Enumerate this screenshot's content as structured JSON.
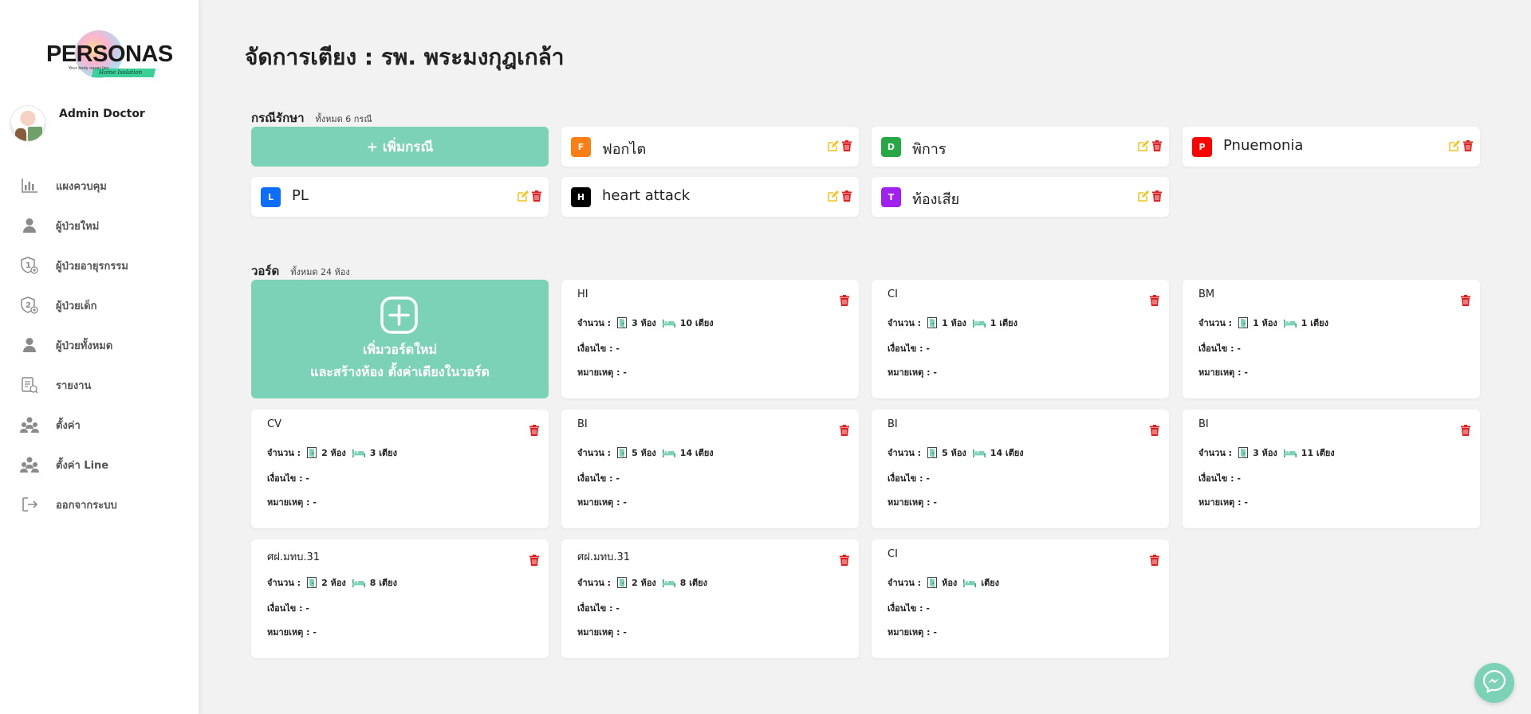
{
  "sidebar": {
    "logo": {
      "text": "PERSONAS",
      "tagline": "Your body never lies",
      "strip": "Home Isolation"
    },
    "profile_name": "Admin Doctor",
    "items": [
      {
        "label": "แผงควบคุม",
        "icon": "bar-chart-icon"
      },
      {
        "label": "ผู้ป่วยใหม่",
        "icon": "user-icon"
      },
      {
        "label": "ผู้ป่วยอายุรกรรม",
        "icon": "shield-one-icon"
      },
      {
        "label": "ผู้ป่วยเด็ก",
        "icon": "shield-two-icon"
      },
      {
        "label": "ผู้ป่วยทั้งหมด",
        "icon": "user-icon"
      },
      {
        "label": "รายงาน",
        "icon": "report-icon"
      },
      {
        "label": "ตั้งค่า",
        "icon": "users-gear-icon"
      },
      {
        "label": "ตั้งค่า Line",
        "icon": "users-gear-icon"
      },
      {
        "label": "ออกจากระบบ",
        "icon": "logout-icon"
      }
    ]
  },
  "main": {
    "title": "จัดการเตียง : รพ. พระมงกุฎเกล้า",
    "cases": {
      "title": "กรณีรักษา",
      "count": "ทั้งหมด 6 กรณี",
      "add_label": "+ เพิ่มกรณี",
      "items": [
        {
          "letter": "F",
          "name": "ฟอกไต",
          "color": "#fd7e14"
        },
        {
          "letter": "D",
          "name": "พิการ",
          "color": "#28a745"
        },
        {
          "letter": "P",
          "name": "Pnuemonia",
          "color": "#ff0000"
        },
        {
          "letter": "L",
          "name": "PL",
          "color": "#0d6efd"
        },
        {
          "letter": "H",
          "name": "heart attack",
          "color": "#000000"
        },
        {
          "letter": "T",
          "name": "ท้องเสีย",
          "color": "#a020f0"
        }
      ]
    },
    "wards": {
      "title": "วอร์ด",
      "count": "ทั้งหมด 24 ห้อง",
      "add_line1": "เพิ่มวอร์ดใหม่",
      "add_line2": "และสร้างห้อง ตั้งค่าเตียงในวอร์ด",
      "amount_label": "จำนวน :",
      "condition_label": "เงื่อนไข : -",
      "note_label": "หมายเหตุ : -",
      "items": [
        {
          "name": "HI",
          "rooms": "3 ห้อง",
          "beds": "10 เตียง"
        },
        {
          "name": "CI",
          "rooms": "1 ห้อง",
          "beds": "1 เตียง"
        },
        {
          "name": "BM",
          "rooms": "1 ห้อง",
          "beds": "1 เตียง"
        },
        {
          "name": "CV",
          "rooms": "2 ห้อง",
          "beds": "3 เตียง"
        },
        {
          "name": "BI",
          "rooms": "5 ห้อง",
          "beds": "14 เตียง"
        },
        {
          "name": "BI",
          "rooms": "5 ห้อง",
          "beds": "14 เตียง"
        },
        {
          "name": "BI",
          "rooms": "3 ห้อง",
          "beds": "11 เตียง"
        },
        {
          "name": "ศฝ.มทบ.31",
          "rooms": "2 ห้อง",
          "beds": "8 เตียง"
        },
        {
          "name": "ศฝ.มทบ.31",
          "rooms": "2 ห้อง",
          "beds": "8 เตียง"
        },
        {
          "name": "CI",
          "rooms": "ห้อง",
          "beds": "เตียง"
        }
      ]
    }
  },
  "colors": {
    "accent": "#7bd2b7",
    "edit": "#f0c419",
    "delete": "#e02020"
  }
}
